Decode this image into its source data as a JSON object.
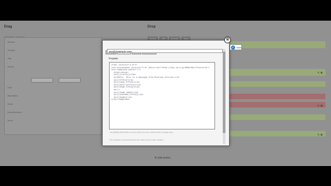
{
  "left_column": {
    "title": "Drag",
    "buttons": [
      "Cancel",
      "Save"
    ],
    "rows": [
      "Dismiss",
      "Activate",
      "Title",
      "Priority",
      "Type",
      "Description",
      "Email",
      "Email Recipient",
      "Notes"
    ]
  },
  "right_column": {
    "title": "Drop",
    "buttons": [
      "Cancel",
      "Add",
      "Activate",
      "Save"
    ],
    "colors": {
      "green": "#b8cf8e",
      "red": "#c67f7f",
      "gray": "#a9a9a9"
    },
    "footer_link": "Add Action"
  },
  "modal": {
    "tabs": [
      "Setup",
      "Template",
      "Test",
      "Advanced"
    ],
    "active_tab": 1,
    "email_value": "me@example.com",
    "template_label": "Template",
    "template_code": "<?xml version=\"1.0\"?>\n<xsl:stylesheet version=\"1.0\" xmlns:xsl=\"http://www.w3.org/1999/XSL/Transform\">\n<xsl:template match=\"/\">\n  <html><body>\n  <h2>[[title]]</h2>\n  <p>Hello, this is a message from Everlaw Actions:</p>\n  <p>[[title]]</p>\n  <p>[[name_title]]</p>\n  <p>[[description]]</p>\n  <p>[[team_title]]</p>\n  <br/>\n  <p>[[team_name]]</p>\n  <p>[[subteam_title]]</p>\n  <p>[[team]]</p>\n</xsl:template>",
    "hint_top": "Use [[field]] placeholders to insert values from the record into the message body.",
    "hint_bottom": "The template is processed before the email is sent to each recipient.",
    "close_glyph": "⊗",
    "apply_glyph": "✔",
    "apply_label": "Apply"
  }
}
